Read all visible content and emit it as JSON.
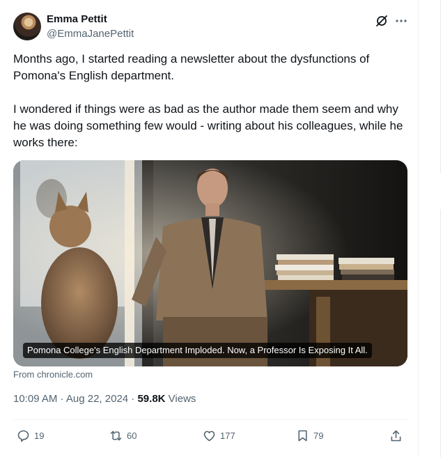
{
  "author": {
    "name": "Emma Pettit",
    "handle": "@EmmaJanePettit"
  },
  "header_icons": [
    "grok-slash-icon",
    "more-icon"
  ],
  "text": {
    "paragraph1": "Months ago, I started reading a newsletter about the dysfunctions of Pomona's English department.",
    "paragraph2": "I wondered if things were as bad as the author made them seem and why he was doing something few would - writing about his colleagues, while he works there:"
  },
  "card": {
    "caption": "Pomona College's English Department Imploded. Now, a Professor Is Exposing It All.",
    "source": "From chronicle.com"
  },
  "meta": {
    "timestamp": "10:09 AM · Aug 22, 2024 · ",
    "views_count": "59.8K",
    "views_label": " Views"
  },
  "actions": {
    "replies": "19",
    "reposts": "60",
    "likes": "177",
    "bookmarks": "79"
  },
  "colors": {
    "text": "#0f1419",
    "secondary": "#536471",
    "divider": "#eff3f4"
  }
}
